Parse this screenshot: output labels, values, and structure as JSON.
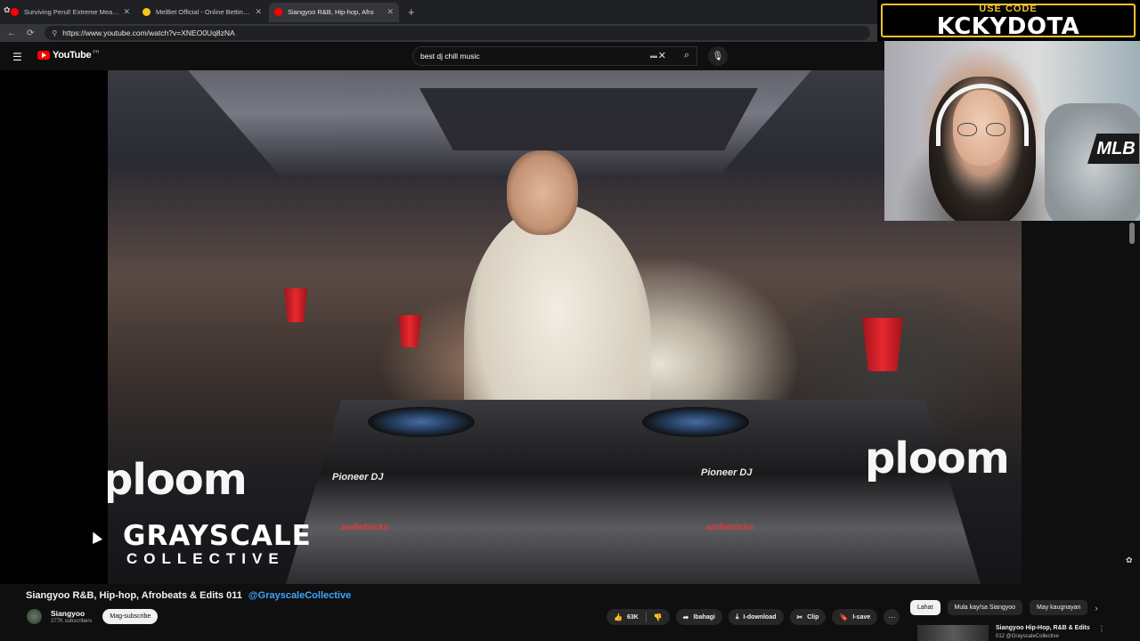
{
  "browser": {
    "tabs": [
      {
        "title": "Surviving Perul! Extreme Meats In",
        "favicon_color": "#ff0000",
        "active": false
      },
      {
        "title": "MelBet Official - Online Betting W",
        "favicon_color": "#f5c518",
        "active": false
      },
      {
        "title": "Siangyoo R&B, Hip-hop, Afro",
        "favicon_color": "#ff0000",
        "active": true
      }
    ],
    "new_tab": "+",
    "url": "https://www.youtube.com/watch?v=XNEO0Uq8zNA"
  },
  "masthead": {
    "logo_text": "YouTube",
    "country": "PH",
    "search_value": "best dj chill music"
  },
  "video": {
    "watermark_line1": "GRAYSCALE",
    "watermark_line2": "COLLECTIVE",
    "brand_left": "ploom",
    "brand_right": "ploom",
    "deck_left": "Pioneer DJ",
    "deck_right": "Pioneer DJ",
    "case_left": "audiotricks",
    "case_right": "audiotricks"
  },
  "overlay": {
    "use_code_label": "USE CODE",
    "code": "KCKYDOTA",
    "sponsor_badge": "MLB"
  },
  "info": {
    "title": "Siangyoo R&B, Hip-hop, Afrobeats & Edits 011",
    "title_handle": "@GrayscaleCollective",
    "channel": "Siangyoo",
    "subscribers": "277K subscribers",
    "subscribe_label": "Mag-subscribe",
    "like_count": "63K",
    "share_label": "Ibahagi",
    "download_label": "I-download",
    "clip_label": "Clip",
    "save_label": "I-save",
    "more_label": "···"
  },
  "sidebar": {
    "chips": [
      "Lahat",
      "Mula kay/sa Siangyoo",
      "May kaugnayan"
    ],
    "selected_chip": "Lahat",
    "rec_title": "Siangyoo Hip-Hop, R&B & Edits",
    "rec_sub": "012 @GrayscaleCollective",
    "rec_more": "⋮"
  },
  "colors": {
    "accent_red": "#ff0000",
    "link_blue": "#3ea6ff",
    "code_gold": "#f6c235",
    "bg": "#0f0f0f"
  }
}
